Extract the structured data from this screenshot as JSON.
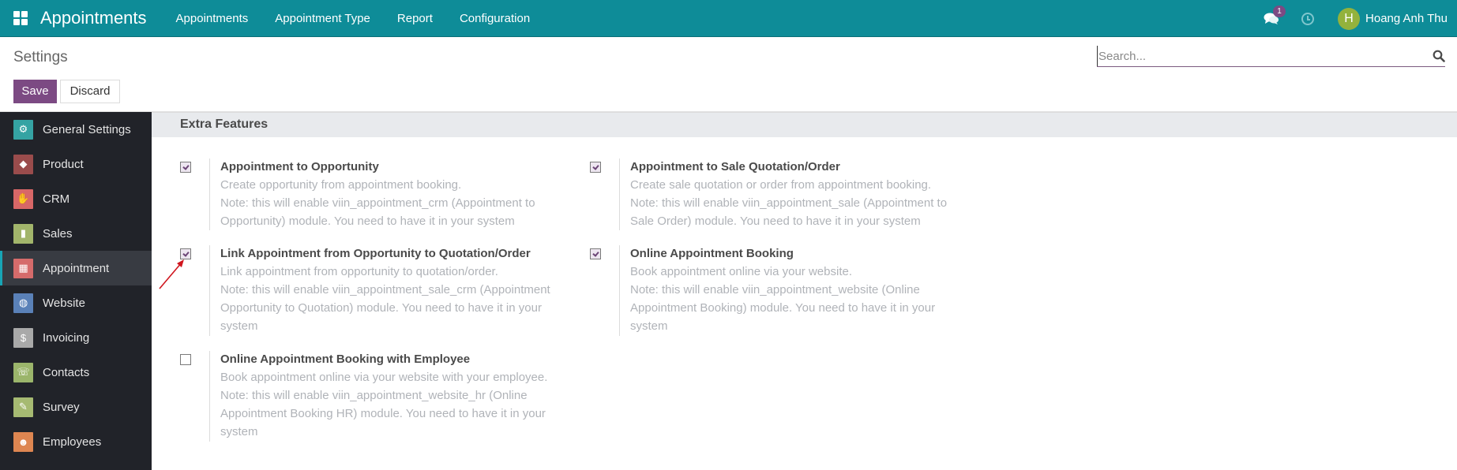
{
  "navbar": {
    "app_title": "Appointments",
    "menu": [
      "Appointments",
      "Appointment Type",
      "Report",
      "Configuration"
    ],
    "chat_badge": "1",
    "user": {
      "initial": "H",
      "name": "Hoang Anh Thu",
      "avatar_color": "#93b23c"
    },
    "bg_color": "#0e8c98"
  },
  "control_panel": {
    "title": "Settings",
    "save_label": "Save",
    "discard_label": "Discard",
    "search_placeholder": "Search...",
    "search_value": ""
  },
  "sidebar": {
    "items": [
      {
        "label": "General Settings",
        "icon": "gear-icon",
        "color": "#35a3a3",
        "active": false
      },
      {
        "label": "Product",
        "icon": "tag-icon",
        "color": "#9a4c4c",
        "active": false
      },
      {
        "label": "CRM",
        "icon": "handshake-icon",
        "color": "#d86767",
        "active": false
      },
      {
        "label": "Sales",
        "icon": "chart-icon",
        "color": "#a2b56b",
        "active": false
      },
      {
        "label": "Appointment",
        "icon": "appointment-icon",
        "color": "#d56b6b",
        "active": true
      },
      {
        "label": "Website",
        "icon": "globe-icon",
        "color": "#5a81b8",
        "active": false
      },
      {
        "label": "Invoicing",
        "icon": "invoice-icon",
        "color": "#a9a9a9",
        "active": false
      },
      {
        "label": "Contacts",
        "icon": "phone-icon",
        "color": "#9bb56b",
        "active": false
      },
      {
        "label": "Survey",
        "icon": "survey-icon",
        "color": "#a6ba72",
        "active": false
      },
      {
        "label": "Employees",
        "icon": "people-icon",
        "color": "#de8651",
        "active": false
      }
    ]
  },
  "section": {
    "title": "Extra Features",
    "settings": [
      {
        "label": "Appointment to Opportunity",
        "checked": true,
        "desc": [
          "Create opportunity from appointment booking.",
          "Note: this will enable viin_appointment_crm (Appointment to",
          "Opportunity) module. You need to have it in your system"
        ]
      },
      {
        "label": "Appointment to Sale Quotation/Order",
        "checked": true,
        "desc": [
          "Create sale quotation or order from appointment booking.",
          "Note: this will enable viin_appointment_sale (Appointment to",
          "Sale Order) module. You need to have it in your system"
        ]
      },
      {
        "label": "Link Appointment from Opportunity to Quotation/Order",
        "checked": true,
        "desc": [
          "Link appointment from opportunity to quotation/order.",
          "Note: this will enable viin_appointment_sale_crm (Appointment",
          "Opportunity to Quotation) module. You need to have it in your",
          "system"
        ]
      },
      {
        "label": "Online Appointment Booking",
        "checked": true,
        "desc": [
          "Book appointment online via your website.",
          "Note: this will enable viin_appointment_website (Online",
          "Appointment Booking) module. You need to have it in your",
          "system"
        ]
      },
      {
        "label": "Online Appointment Booking with Employee",
        "checked": false,
        "desc": [
          "Book appointment online via your website with your employee.",
          "Note: this will enable viin_appointment_website_hr (Online",
          "Appointment Booking HR) module. You need to have it in your",
          "system"
        ]
      }
    ]
  },
  "annotation": {
    "type": "red-arrow",
    "color": "#d0161e",
    "points_to": "Link Appointment from Opportunity to Quotation/Order checkbox"
  }
}
